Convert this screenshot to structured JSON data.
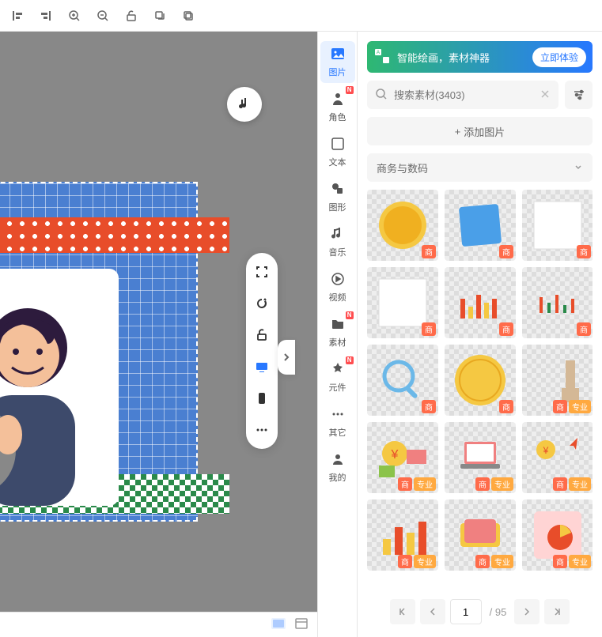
{
  "toolbar": {
    "icons": [
      "align-left",
      "align-right",
      "zoom-in",
      "zoom-out",
      "unlock",
      "copy",
      "paste"
    ]
  },
  "floating_tools": [
    "fullscreen",
    "rotate",
    "unlock",
    "display",
    "mobile",
    "more"
  ],
  "side_tabs": [
    {
      "id": "image",
      "label": "图片",
      "active": true,
      "badge": false
    },
    {
      "id": "role",
      "label": "角色",
      "active": false,
      "badge": "N"
    },
    {
      "id": "text",
      "label": "文本",
      "active": false,
      "badge": false
    },
    {
      "id": "shape",
      "label": "图形",
      "active": false,
      "badge": false
    },
    {
      "id": "music",
      "label": "音乐",
      "active": false,
      "badge": false
    },
    {
      "id": "video",
      "label": "视频",
      "active": false,
      "badge": false
    },
    {
      "id": "material",
      "label": "素材",
      "active": false,
      "badge": "N"
    },
    {
      "id": "component",
      "label": "元件",
      "active": false,
      "badge": "N"
    },
    {
      "id": "other",
      "label": "其它",
      "active": false,
      "badge": false
    },
    {
      "id": "mine",
      "label": "我的",
      "active": false,
      "badge": false
    }
  ],
  "promo": {
    "text": "智能绘画，素材神器",
    "button": "立即体验"
  },
  "search": {
    "placeholder": "搜索素材(3403)"
  },
  "add_button": "添加图片",
  "category": {
    "selected": "商务与数码"
  },
  "badges": {
    "commercial": "商",
    "professional": "专业"
  },
  "materials": [
    {
      "type": "coin",
      "badges": [
        "commercial"
      ]
    },
    {
      "type": "note",
      "badges": [
        "commercial"
      ]
    },
    {
      "type": "blank1",
      "badges": [
        "commercial"
      ]
    },
    {
      "type": "blank2",
      "badges": [
        "commercial"
      ]
    },
    {
      "type": "chart1",
      "badges": [
        "commercial"
      ]
    },
    {
      "type": "chart2",
      "badges": [
        "commercial"
      ]
    },
    {
      "type": "magnifier",
      "badges": [
        "commercial"
      ]
    },
    {
      "type": "coin2",
      "badges": [
        "commercial"
      ]
    },
    {
      "type": "flask",
      "badges": [
        "commercial",
        "professional"
      ]
    },
    {
      "type": "money",
      "badges": [
        "commercial",
        "professional"
      ]
    },
    {
      "type": "laptop",
      "badges": [
        "commercial",
        "professional"
      ]
    },
    {
      "type": "growth",
      "badges": [
        "commercial",
        "professional"
      ]
    },
    {
      "type": "bars",
      "badges": [
        "commercial",
        "professional"
      ]
    },
    {
      "type": "ticket",
      "badges": [
        "commercial",
        "professional"
      ]
    },
    {
      "type": "pie",
      "badges": [
        "commercial",
        "professional"
      ]
    }
  ],
  "pagination": {
    "current": "1",
    "total": "/ 95"
  }
}
